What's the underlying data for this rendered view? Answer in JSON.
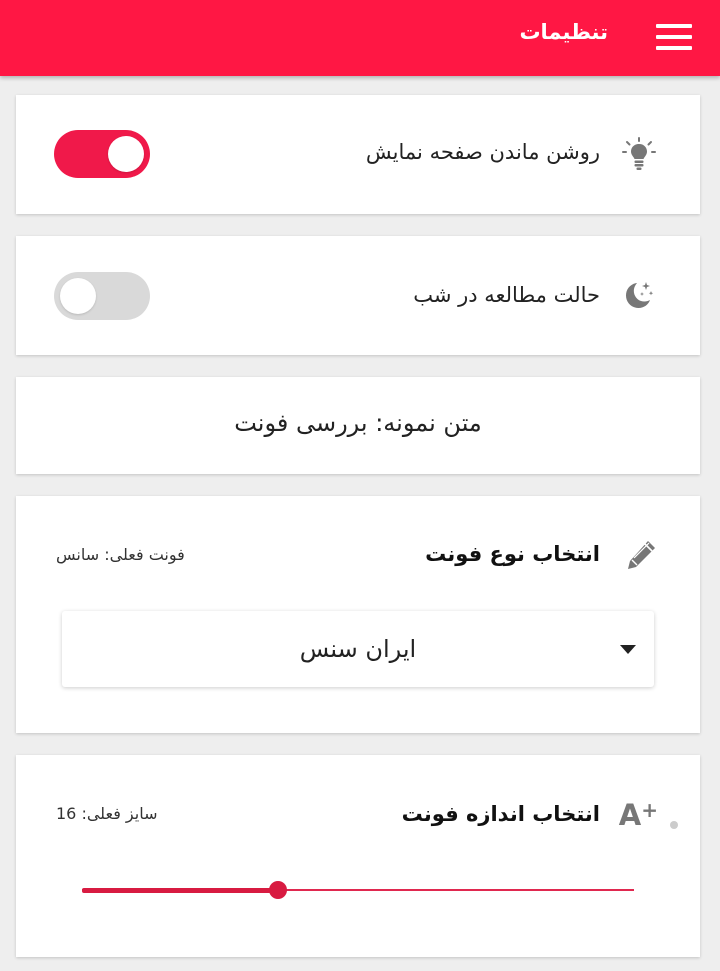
{
  "appbar": {
    "title": "تنظیمات",
    "background": "#ff1744"
  },
  "keep_screen_on": {
    "label": "روشن ماندن صفحه نمایش",
    "icon": "lightbulb-icon",
    "enabled": true
  },
  "night_mode": {
    "label": "حالت مطالعه در شب",
    "icon": "moon-stars-icon",
    "enabled": false
  },
  "sample_text": "متن نمونه: بررسی فونت",
  "font_type": {
    "title": "انتخاب نوع فونت",
    "current": "فونت فعلی: سانس",
    "icon": "pencil-icon",
    "selected": "ایران سنس"
  },
  "font_size": {
    "title": "انتخاب اندازه فونت",
    "current": "سایز فعلی: 16",
    "icon": "font-size-increase-icon",
    "icon_text": "A",
    "icon_plus": "+",
    "slider_fraction": 0.355
  },
  "colors": {
    "accent": "#f0194a",
    "toggle_off": "#d9d9d9"
  }
}
